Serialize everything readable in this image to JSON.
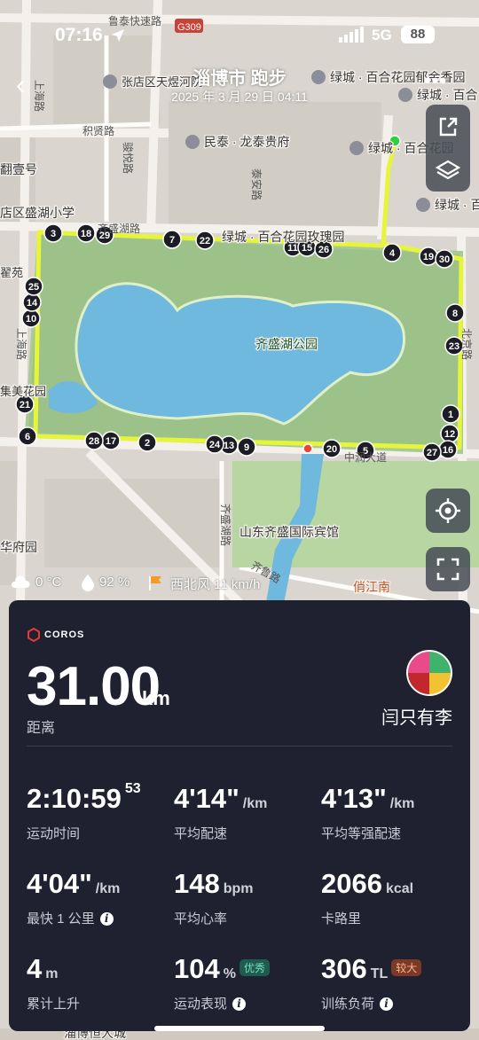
{
  "status_bar": {
    "time": "07:16",
    "network": "5G",
    "battery": "88",
    "location_icon": "location-arrow-icon"
  },
  "header": {
    "title": "淄博市 跑步",
    "subtitle": "2025 年 3 月 29 日 04:11",
    "back_icon": "back-chevron-icon",
    "more_icon": "more-dots-icon"
  },
  "map": {
    "road_labels": {
      "north": "鲁泰快速路",
      "highway": "G309",
      "west": "上海路",
      "west2": "上海路",
      "south": "中润大道",
      "east": "北京路",
      "gyh": "积贤路",
      "swl": "齐盛湖路",
      "mid1": "骏悦路",
      "mid2": "泰安路",
      "ql": "齐鲁路",
      "park_road": "齐盛湖路"
    },
    "poi": [
      {
        "name": "张店区天煜河院"
      },
      {
        "name": "绿城 · 百合花园郁金香园"
      },
      {
        "name": "绿城 · 百合"
      },
      {
        "name": "民泰 · 龙泰贵府"
      },
      {
        "name": "绿城 · 百合花园"
      },
      {
        "name": "绿城 · 百合花园玫瑰园"
      },
      {
        "name": "绿城 · 百"
      },
      {
        "name": "店区盛湖小学"
      },
      {
        "name": "翻壹号"
      },
      {
        "name": "齐盛湖公园"
      },
      {
        "name": "集美花园"
      },
      {
        "name": "翟苑"
      },
      {
        "name": "山东齐盛国际宾馆"
      },
      {
        "name": "华府园"
      },
      {
        "name": "俏江南"
      },
      {
        "name": "淄博恒大城"
      }
    ],
    "km_markers": [
      "1",
      "2",
      "3",
      "4",
      "5",
      "6",
      "7",
      "8",
      "9",
      "10",
      "11",
      "12",
      "13",
      "14",
      "15",
      "16",
      "17",
      "18",
      "19",
      "20",
      "21",
      "22",
      "23",
      "24",
      "25",
      "26",
      "27",
      "28",
      "29",
      "30"
    ],
    "route_color": "#e7f53a"
  },
  "map_controls": {
    "share_icon": "share-icon",
    "layers_icon": "layers-icon",
    "locate_icon": "locate-icon",
    "fullscreen_icon": "fullscreen-icon"
  },
  "weather": {
    "temp": "0 °C",
    "humidity": "92 %",
    "wind": "西北风 11 km/h"
  },
  "card": {
    "brand": "COROS",
    "distance_value": "31.00",
    "distance_unit": "km",
    "distance_label": "距离",
    "user_name": "闫只有李",
    "metrics": {
      "time": {
        "value": "2:10:59",
        "sup": "53",
        "label": "运动时间"
      },
      "pace": {
        "value": "4'14\"",
        "unit": "/km",
        "label": "平均配速"
      },
      "grade_pace": {
        "value": "4'13\"",
        "unit": "/km",
        "label": "平均等强配速"
      },
      "fastest": {
        "value": "4'04\"",
        "unit": "/km",
        "label": "最快 1 公里"
      },
      "hr": {
        "value": "148",
        "unit": "bpm",
        "label": "平均心率"
      },
      "cal": {
        "value": "2066",
        "unit": "kcal",
        "label": "卡路里"
      },
      "ascent": {
        "value": "4",
        "unit": "m",
        "label": "累计上升"
      },
      "performance": {
        "value": "104",
        "unit": "%",
        "tag": "优秀",
        "label": "运动表现"
      },
      "load": {
        "value": "306",
        "unit": "TL",
        "tag": "较大",
        "label": "训练负荷"
      }
    }
  }
}
